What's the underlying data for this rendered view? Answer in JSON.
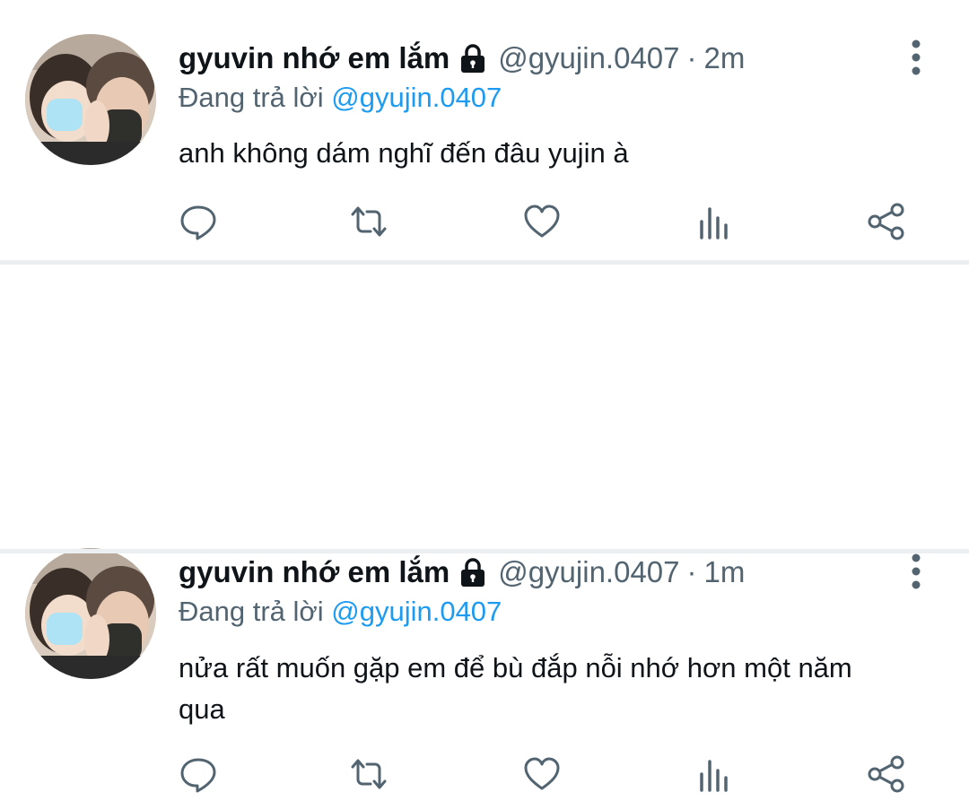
{
  "tweets": [
    {
      "display_name": "gyuvin nhớ em lắm",
      "handle": "@gyujin.0407",
      "separator": "·",
      "time": "2m",
      "reply_prefix": "Đang trả lời",
      "reply_to": "@gyujin.0407",
      "text": "anh không dám nghĩ đến đâu yujin à"
    },
    {
      "display_name": "gyuvin nhớ em lắm",
      "handle": "@gyujin.0407",
      "separator": "·",
      "time": "1m",
      "reply_prefix": "Đang trả lời",
      "reply_to": "@gyujin.0407",
      "text": "nửa rất muốn gặp em để bù đắp nỗi nhớ hơn một năm qua"
    }
  ],
  "icons": {
    "lock": "lock-icon",
    "more": "more-vertical-icon",
    "reply": "comment-icon",
    "retweet": "retweet-icon",
    "like": "heart-icon",
    "stats": "analytics-icon",
    "share": "share-icon"
  },
  "colors": {
    "name": "#0f1419",
    "meta": "#536471",
    "mention": "#1d9bf0",
    "separator": "#eceff1"
  }
}
